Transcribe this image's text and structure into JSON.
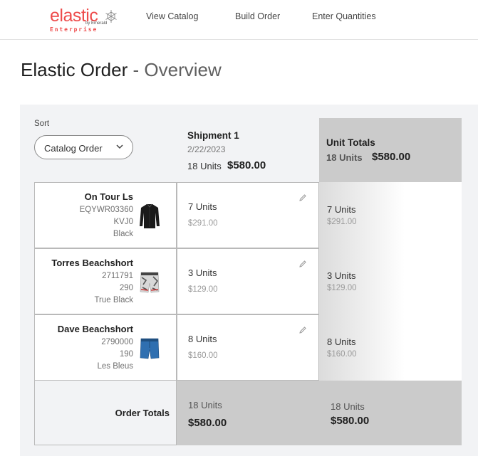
{
  "header": {
    "logo": {
      "word": "elastic",
      "by": "by Emerald",
      "tagline": "Enterprise",
      "mark_icon": "snowflake-icon"
    },
    "nav": [
      "View Catalog",
      "Build Order",
      "Enter Quantities"
    ]
  },
  "page": {
    "title": "Elastic Order",
    "subtitle": "- Overview"
  },
  "sort": {
    "label": "Sort",
    "value": "Catalog Order",
    "icon": "chevron-down-icon"
  },
  "shipment": {
    "title": "Shipment 1",
    "date": "2/22/2023",
    "units": "18 Units",
    "amount": "$580.00"
  },
  "unit_totals": {
    "title": "Unit Totals",
    "units": "18 Units",
    "amount": "$580.00"
  },
  "products": [
    {
      "name": "On Tour Ls",
      "sku": "EQYWR03360",
      "variant": "KVJ0",
      "color": "Black",
      "image_icon": "long-sleeve-rashguard-icon",
      "qty_units": "7 Units",
      "qty_price": "$291.00",
      "total_units": "7 Units",
      "total_price": "$291.00"
    },
    {
      "name": "Torres Beachshort",
      "sku": "2711791",
      "variant": "290",
      "color": "True Black",
      "image_icon": "patterned-boardshort-icon",
      "qty_units": "3 Units",
      "qty_price": "$129.00",
      "total_units": "3 Units",
      "total_price": "$129.00"
    },
    {
      "name": "Dave Beachshort",
      "sku": "2790000",
      "variant": "190",
      "color": "Les Bleus",
      "image_icon": "blue-boardshort-icon",
      "qty_units": "8 Units",
      "qty_price": "$160.00",
      "total_units": "8 Units",
      "total_price": "$160.00"
    }
  ],
  "order_totals": {
    "label": "Order Totals",
    "shipment_units": "18 Units",
    "shipment_amount": "$580.00",
    "total_units": "18 Units",
    "total_amount": "$580.00"
  },
  "colors": {
    "brand": "#ee4b4b",
    "panel_bg": "#f2f3f5",
    "totals_bg": "#cbcbcb"
  }
}
